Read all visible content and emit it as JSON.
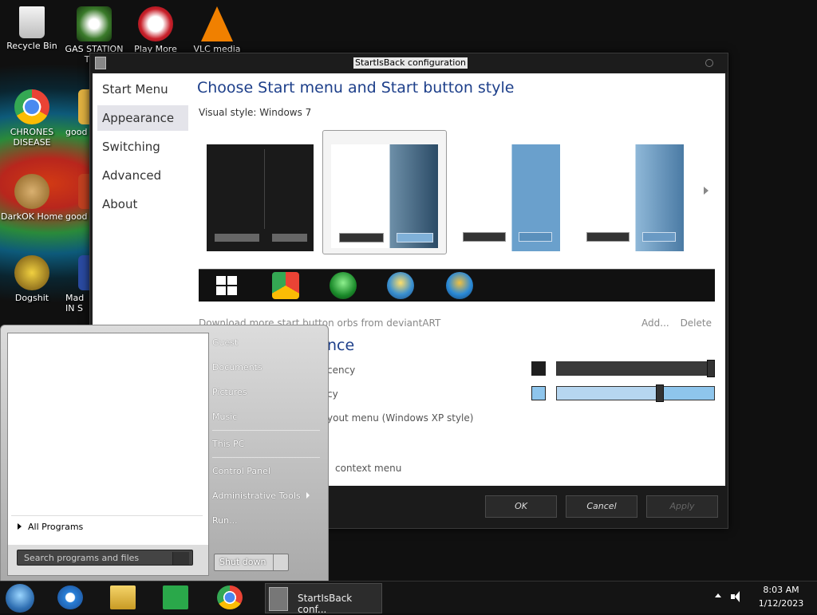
{
  "desktop": {
    "icons": [
      {
        "label": "Recycle Bin"
      },
      {
        "label": "GAS STATION TWE"
      },
      {
        "label": "Play More"
      },
      {
        "label": "VLC media"
      },
      {
        "label": "CHRONES DISEASE"
      },
      {
        "label": "good"
      },
      {
        "label": "DarkOK Home"
      },
      {
        "label": "good"
      },
      {
        "label": "Dogshit"
      },
      {
        "label": "Mad IN S"
      }
    ]
  },
  "window": {
    "title": "StartIsBack configuration",
    "nav": [
      "Start Menu",
      "Appearance",
      "Switching",
      "Advanced",
      "About"
    ],
    "heading": "Choose Start menu and Start button style",
    "visual_style_label": "Visual style:",
    "visual_style_value": "Windows 7",
    "download_link": "Download more start button orbs from deviantART",
    "add_link": "Add...",
    "delete_link": "Delete",
    "section_heading_partial": "nce",
    "options": [
      "cency",
      "cy",
      "yout menu (Windows XP style)",
      "context menu"
    ],
    "buttons": {
      "ok": "OK",
      "cancel": "Cancel",
      "apply": "Apply"
    },
    "sliders": [
      {
        "swatch_color": "#1e1e1e",
        "level": 1.0
      },
      {
        "swatch_color": "#8ec5ec",
        "level": 0.65
      }
    ]
  },
  "start_menu": {
    "items": [
      "Guest",
      "Documents",
      "Pictures",
      "Music",
      "This PC",
      "Control Panel",
      "Administrative Tools",
      "Run..."
    ],
    "all_programs": "All Programs",
    "search_placeholder": "Search programs and files",
    "shutdown": "Shut down"
  },
  "taskbar": {
    "task_label": "StartIsBack conf...",
    "time": "8:03 AM",
    "date": "1/12/2023"
  }
}
